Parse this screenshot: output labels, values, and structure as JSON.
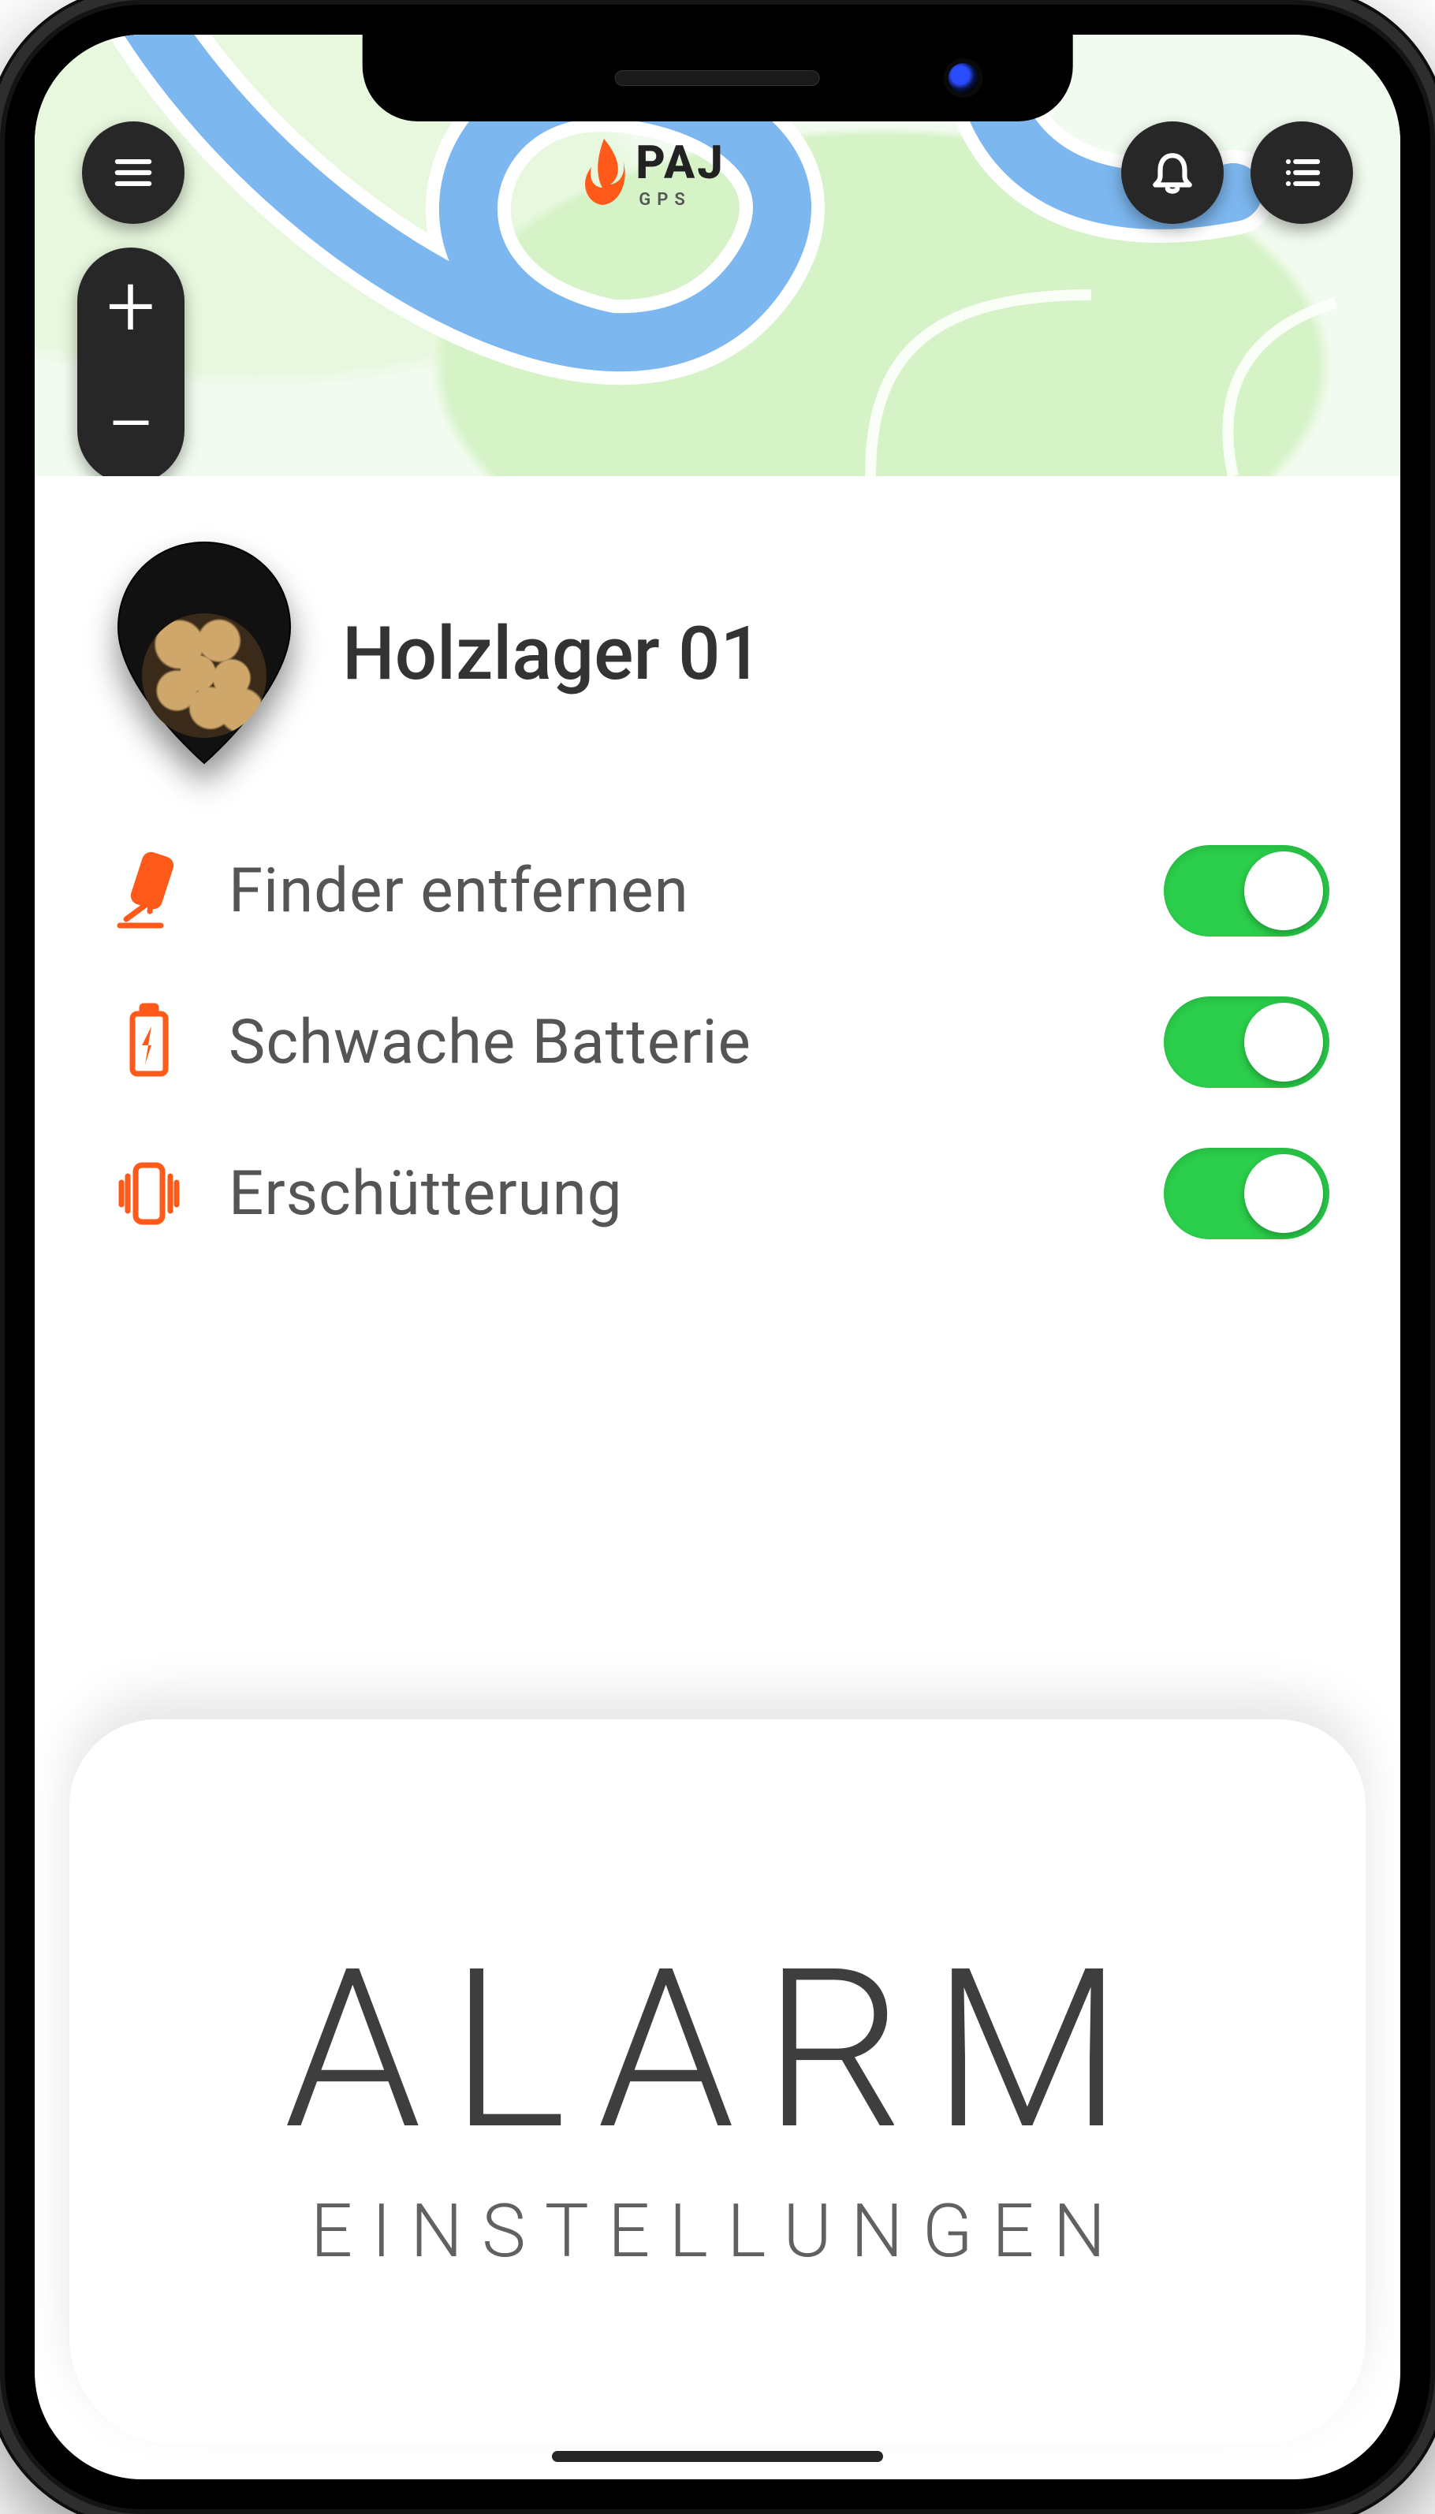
{
  "brand": {
    "name": "PAJ",
    "sub": "GPS"
  },
  "header_icons": {
    "menu": "menu-icon",
    "bell": "bell-icon",
    "list": "list-icon",
    "zoom_in": "+",
    "zoom_out": "−"
  },
  "tracker": {
    "title": "Holzlager 01",
    "pin_image": "wood-logs"
  },
  "alarms": [
    {
      "id": "remove-finder",
      "label": "Finder entfernen",
      "icon": "remove-finder-icon",
      "on": true
    },
    {
      "id": "low-battery",
      "label": "Schwache Batterie",
      "icon": "low-battery-icon",
      "on": true
    },
    {
      "id": "vibration",
      "label": "Erschütterung",
      "icon": "vibration-icon",
      "on": true
    }
  ],
  "footer": {
    "title": "ALARM",
    "subtitle": "EINSTELLUNGEN"
  },
  "colors": {
    "accent": "#ff5a1a",
    "toggle_on": "#2bcf4b"
  }
}
